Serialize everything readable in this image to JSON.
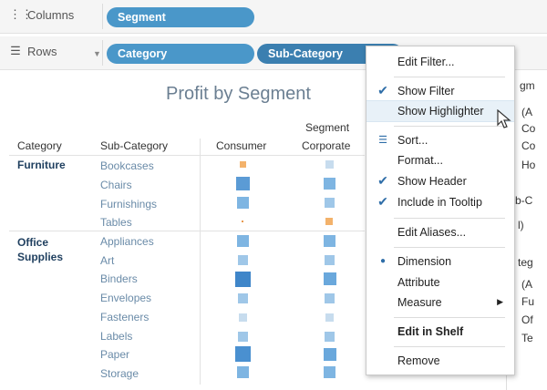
{
  "shelves": {
    "columns": {
      "label": "Columns",
      "pills": [
        "Segment"
      ]
    },
    "rows": {
      "label": "Rows",
      "pills": [
        "Category",
        "Sub-Category"
      ]
    }
  },
  "view": {
    "title": "Profit by Segment",
    "segment_header": "Segment",
    "col_headers": {
      "category": "Category",
      "subcategory": "Sub-Category",
      "consumer": "Consumer",
      "corporate": "Corporate"
    },
    "groups": [
      {
        "category": "Furniture",
        "subs": [
          "Bookcases",
          "Chairs",
          "Furnishings",
          "Tables"
        ]
      },
      {
        "category": "Office Supplies",
        "subs": [
          "Appliances",
          "Art",
          "Binders",
          "Envelopes",
          "Fasteners",
          "Labels",
          "Paper",
          "Storage"
        ]
      }
    ]
  },
  "right_panel": {
    "items": [
      "gm",
      "(A",
      "Co",
      "Co",
      "Ho",
      "b-C",
      "l)",
      "teg",
      "(A",
      "Fu",
      "Of",
      "Te"
    ]
  },
  "menu": {
    "items": [
      {
        "label": "Edit Filter..."
      },
      {
        "label": "Show Filter",
        "checked": true
      },
      {
        "label": "Show Highlighter",
        "highlighted": true
      },
      {
        "label": "Sort..."
      },
      {
        "label": "Format..."
      },
      {
        "label": "Show Header",
        "checked": true
      },
      {
        "label": "Include in Tooltip",
        "checked": true
      },
      {
        "label": "Edit Aliases..."
      },
      {
        "label": "Dimension",
        "selected": true
      },
      {
        "label": "Attribute"
      },
      {
        "label": "Measure",
        "submenu": true
      },
      {
        "label": "Edit in Shelf",
        "bold": true
      },
      {
        "label": "Remove"
      }
    ]
  },
  "colors": {
    "pill": "#4a97c9",
    "pill_active": "#3b7fb0",
    "mark_orange": "#f3b26b",
    "mark_blue_light": "#b9d6ee",
    "mark_blue_mid": "#7eb5e2",
    "mark_blue_dark": "#3f86c9"
  }
}
